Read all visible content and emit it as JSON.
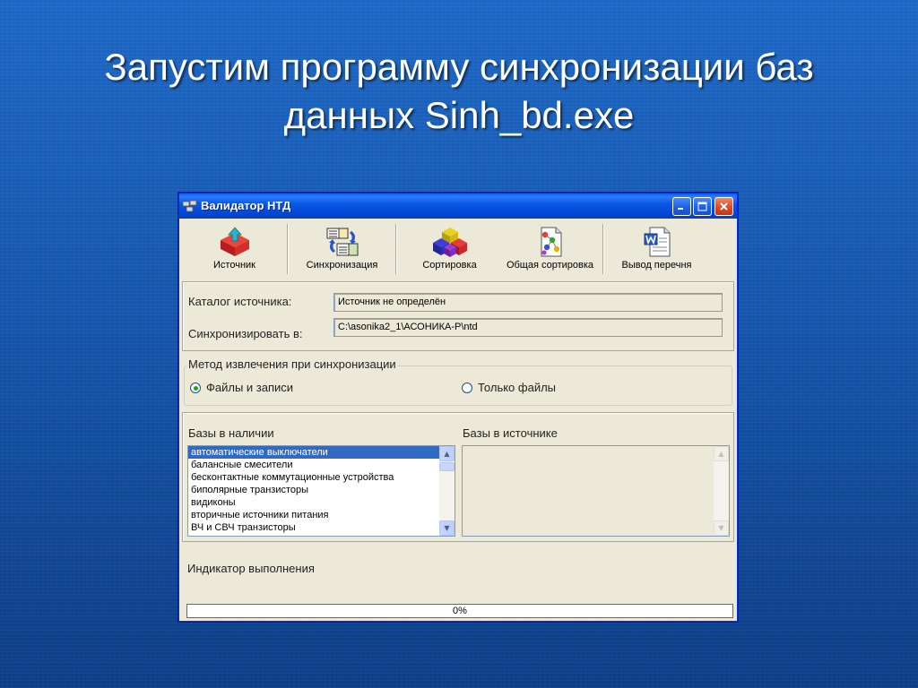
{
  "slide": {
    "title_line1": "Запустим программу синхронизации баз",
    "title_line2": "данных Sinh_bd.exe"
  },
  "window": {
    "title": "Валидатор НТД",
    "controls": {
      "minimize": "minimize-icon",
      "maximize": "maximize-icon",
      "close": "close-icon"
    }
  },
  "toolbar": {
    "items": [
      {
        "label": "Источник",
        "icon": "source-icon"
      },
      {
        "label": "Синхронизация",
        "icon": "sync-books-icon"
      },
      {
        "label": "Сортировка",
        "icon": "sort-cubes-icon"
      },
      {
        "label": "Общая сортировка",
        "icon": "document-molecule-icon"
      },
      {
        "label": "Вывод перечня",
        "icon": "word-document-icon"
      }
    ]
  },
  "paths": {
    "source_label": "Каталог источника:",
    "source_value": "Источник не определён",
    "sync_label": "Синхронизировать в:",
    "sync_value": "C:\\asonika2_1\\АСОНИКА-Р\\ntd"
  },
  "method": {
    "caption": "Метод извлечения при синхронизации",
    "options": [
      {
        "label": "Файлы и записи",
        "selected": true
      },
      {
        "label": "Только файлы",
        "selected": false
      }
    ]
  },
  "bases": {
    "available_label": "Базы в наличии",
    "source_label": "Базы в источнике",
    "available_items": [
      "автоматические выключатели",
      "балансные смесители",
      "бесконтактные коммутационные устройства",
      "биполярные транзисторы",
      "видиконы",
      "вторичные источники питания",
      "ВЧ и СВЧ транзисторы"
    ],
    "selected_index": 0,
    "source_items": []
  },
  "progress": {
    "label": "Индикатор выполнения",
    "value": 0,
    "text": "0%"
  },
  "colors": {
    "title_bar": "#0a58e6",
    "selection": "#316ac5",
    "window_bg": "#ece9d8",
    "close_button": "#de4a22"
  }
}
